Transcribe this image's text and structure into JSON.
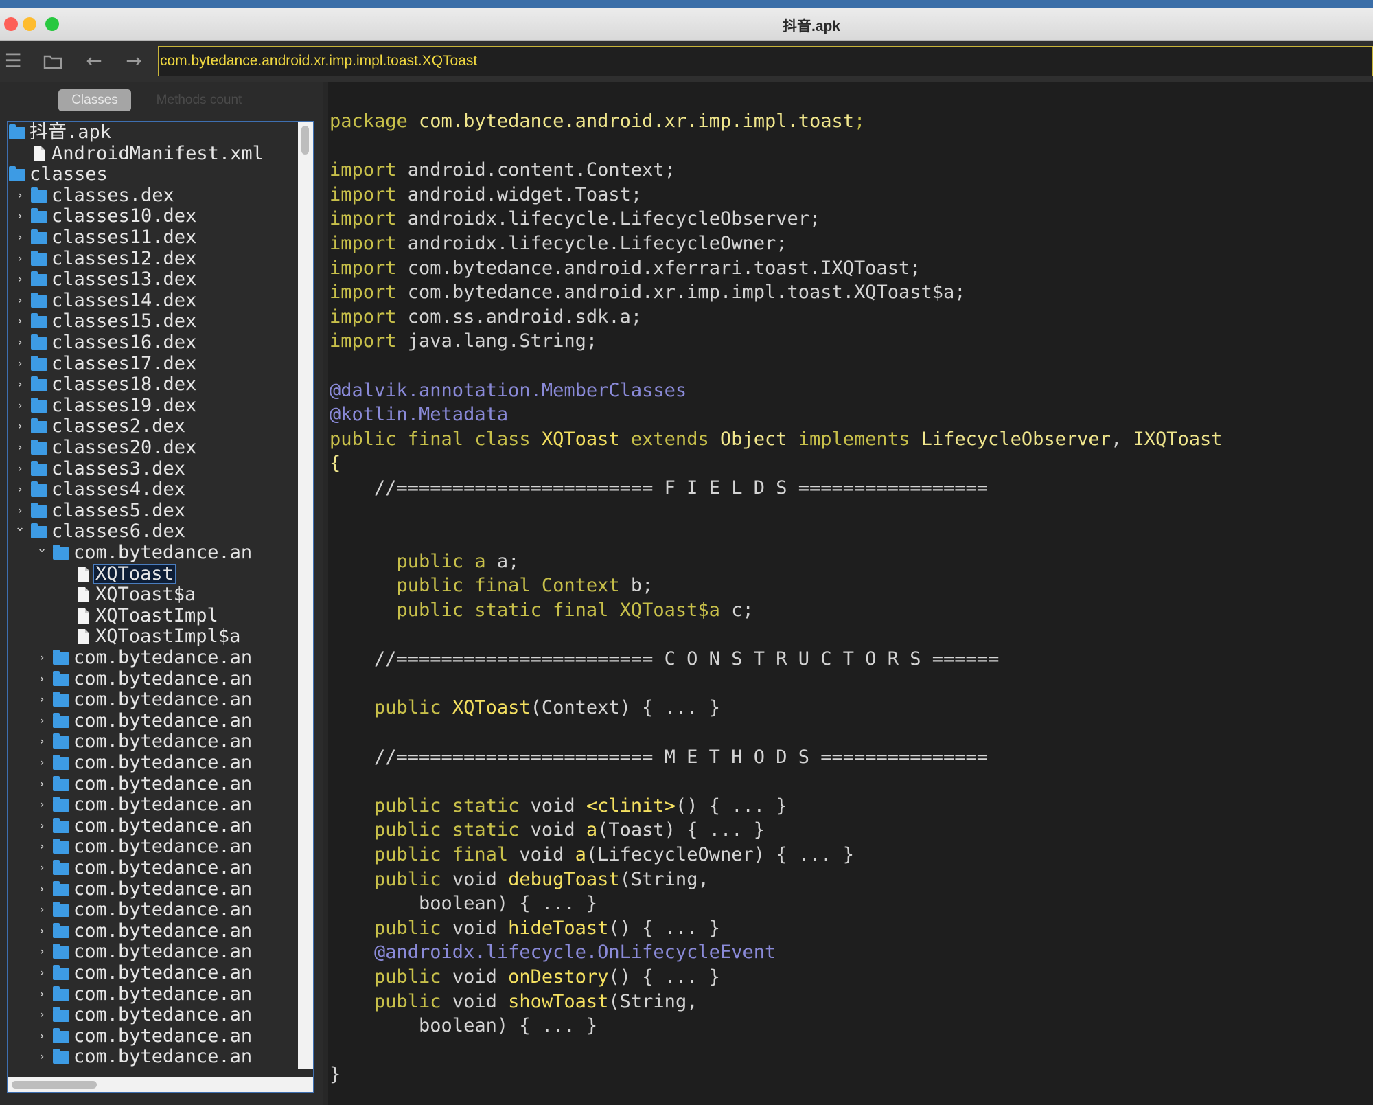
{
  "window": {
    "title": "抖音.apk",
    "address": "com.bytedance.android.xr.imp.impl.toast.XQToast",
    "colors": {
      "close": "#fd5f57",
      "minimize": "#febc2e",
      "maximize": "#28c840",
      "accent": "#3d9be4"
    }
  },
  "toolbar_icons": [
    "menu-icon",
    "folder-icon",
    "back-arrow-icon",
    "forward-arrow-icon"
  ],
  "tabs": {
    "classes": "Classes",
    "methods": "Methods count"
  },
  "tree": [
    {
      "text": "抖音.apk",
      "level": 0,
      "icon": "folder",
      "chev": ""
    },
    {
      "text": "AndroidManifest.xml",
      "level": 1,
      "icon": "file",
      "chev": ""
    },
    {
      "text": "classes",
      "level": 0,
      "icon": "folder",
      "chev": "v"
    },
    {
      "text": "classes.dex",
      "level": 1,
      "icon": "folder",
      "chev": ">"
    },
    {
      "text": "classes10.dex",
      "level": 1,
      "icon": "folder",
      "chev": ">"
    },
    {
      "text": "classes11.dex",
      "level": 1,
      "icon": "folder",
      "chev": ">"
    },
    {
      "text": "classes12.dex",
      "level": 1,
      "icon": "folder",
      "chev": ">"
    },
    {
      "text": "classes13.dex",
      "level": 1,
      "icon": "folder",
      "chev": ">"
    },
    {
      "text": "classes14.dex",
      "level": 1,
      "icon": "folder",
      "chev": ">"
    },
    {
      "text": "classes15.dex",
      "level": 1,
      "icon": "folder",
      "chev": ">"
    },
    {
      "text": "classes16.dex",
      "level": 1,
      "icon": "folder",
      "chev": ">"
    },
    {
      "text": "classes17.dex",
      "level": 1,
      "icon": "folder",
      "chev": ">"
    },
    {
      "text": "classes18.dex",
      "level": 1,
      "icon": "folder",
      "chev": ">"
    },
    {
      "text": "classes19.dex",
      "level": 1,
      "icon": "folder",
      "chev": ">"
    },
    {
      "text": "classes2.dex",
      "level": 1,
      "icon": "folder",
      "chev": ">"
    },
    {
      "text": "classes20.dex",
      "level": 1,
      "icon": "folder",
      "chev": ">"
    },
    {
      "text": "classes3.dex",
      "level": 1,
      "icon": "folder",
      "chev": ">"
    },
    {
      "text": "classes4.dex",
      "level": 1,
      "icon": "folder",
      "chev": ">"
    },
    {
      "text": "classes5.dex",
      "level": 1,
      "icon": "folder",
      "chev": ">"
    },
    {
      "text": "classes6.dex",
      "level": 1,
      "icon": "folder",
      "chev": "v"
    },
    {
      "text": "com.bytedance.an",
      "level": 2,
      "icon": "folder",
      "chev": "v"
    },
    {
      "text": "XQToast",
      "level": 3,
      "icon": "file",
      "chev": "",
      "selected": true
    },
    {
      "text": "XQToast$a",
      "level": 3,
      "icon": "file",
      "chev": ""
    },
    {
      "text": "XQToastImpl",
      "level": 3,
      "icon": "file",
      "chev": ""
    },
    {
      "text": "XQToastImpl$a",
      "level": 3,
      "icon": "file",
      "chev": ""
    },
    {
      "text": "com.bytedance.an",
      "level": 2,
      "icon": "folder",
      "chev": ">"
    },
    {
      "text": "com.bytedance.an",
      "level": 2,
      "icon": "folder",
      "chev": ">"
    },
    {
      "text": "com.bytedance.an",
      "level": 2,
      "icon": "folder",
      "chev": ">"
    },
    {
      "text": "com.bytedance.an",
      "level": 2,
      "icon": "folder",
      "chev": ">"
    },
    {
      "text": "com.bytedance.an",
      "level": 2,
      "icon": "folder",
      "chev": ">"
    },
    {
      "text": "com.bytedance.an",
      "level": 2,
      "icon": "folder",
      "chev": ">"
    },
    {
      "text": "com.bytedance.an",
      "level": 2,
      "icon": "folder",
      "chev": ">"
    },
    {
      "text": "com.bytedance.an",
      "level": 2,
      "icon": "folder",
      "chev": ">"
    },
    {
      "text": "com.bytedance.an",
      "level": 2,
      "icon": "folder",
      "chev": ">"
    },
    {
      "text": "com.bytedance.an",
      "level": 2,
      "icon": "folder",
      "chev": ">"
    },
    {
      "text": "com.bytedance.an",
      "level": 2,
      "icon": "folder",
      "chev": ">"
    },
    {
      "text": "com.bytedance.an",
      "level": 2,
      "icon": "folder",
      "chev": ">"
    },
    {
      "text": "com.bytedance.an",
      "level": 2,
      "icon": "folder",
      "chev": ">"
    },
    {
      "text": "com.bytedance.an",
      "level": 2,
      "icon": "folder",
      "chev": ">"
    },
    {
      "text": "com.bytedance.an",
      "level": 2,
      "icon": "folder",
      "chev": ">"
    },
    {
      "text": "com.bytedance.an",
      "level": 2,
      "icon": "folder",
      "chev": ">"
    },
    {
      "text": "com.bytedance.an",
      "level": 2,
      "icon": "folder",
      "chev": ">"
    },
    {
      "text": "com.bytedance.an",
      "level": 2,
      "icon": "folder",
      "chev": ">"
    },
    {
      "text": "com.bytedance.an",
      "level": 2,
      "icon": "folder",
      "chev": ">"
    },
    {
      "text": "com.bytedance.an",
      "level": 2,
      "icon": "folder",
      "chev": ">"
    }
  ],
  "code": [
    [
      [
        "kw",
        "package "
      ],
      [
        "ty",
        "com.bytedance.android.xr.imp.impl.toast"
      ],
      [
        "kw",
        ";"
      ]
    ],
    [],
    [
      [
        "kw",
        "import "
      ],
      [
        "",
        "android.content.Context;"
      ]
    ],
    [
      [
        "kw",
        "import "
      ],
      [
        "",
        "android.widget.Toast;"
      ]
    ],
    [
      [
        "kw",
        "import "
      ],
      [
        "",
        "androidx.lifecycle.LifecycleObserver;"
      ]
    ],
    [
      [
        "kw",
        "import "
      ],
      [
        "",
        "androidx.lifecycle.LifecycleOwner;"
      ]
    ],
    [
      [
        "kw",
        "import "
      ],
      [
        "",
        "com.bytedance.android.xferrari.toast.IXQToast;"
      ]
    ],
    [
      [
        "kw",
        "import "
      ],
      [
        "",
        "com.bytedance.android.xr.imp.impl.toast.XQToast$a;"
      ]
    ],
    [
      [
        "kw",
        "import "
      ],
      [
        "",
        "com.ss.android.sdk.a;"
      ]
    ],
    [
      [
        "kw",
        "import "
      ],
      [
        "",
        "java.lang.String;"
      ]
    ],
    [],
    [
      [
        "an",
        "@dalvik.annotation.MemberClasses"
      ]
    ],
    [
      [
        "an",
        "@kotlin.Metadata"
      ]
    ],
    [
      [
        "kw",
        "public final class "
      ],
      [
        "nm",
        "XQToast"
      ],
      [
        "kw",
        " extends "
      ],
      [
        "ty",
        "Object"
      ],
      [
        "kw",
        " implements "
      ],
      [
        "ty",
        "LifecycleObserver"
      ],
      [
        "",
        ", "
      ],
      [
        "ty",
        "IXQToast"
      ]
    ],
    [
      [
        "ty",
        "{"
      ]
    ],
    [
      [
        "",
        "    //======================= F I E L D S ================="
      ]
    ],
    [],
    [],
    [
      [
        "kw",
        "      public "
      ],
      [
        "kw",
        "a "
      ],
      [
        "",
        "a;"
      ]
    ],
    [
      [
        "kw",
        "      public final "
      ],
      [
        "kw",
        "Context "
      ],
      [
        "",
        "b;"
      ]
    ],
    [
      [
        "kw",
        "      public static final "
      ],
      [
        "kw",
        "XQToast$a "
      ],
      [
        "",
        "c;"
      ]
    ],
    [],
    [
      [
        "",
        "    //======================= C O N S T R U C T O R S ======"
      ]
    ],
    [],
    [
      [
        "kw",
        "    public "
      ],
      [
        "nm",
        "XQToast"
      ],
      [
        "",
        "(Context) { ... }"
      ]
    ],
    [],
    [
      [
        "",
        "    //======================= M E T H O D S ==============="
      ]
    ],
    [],
    [
      [
        "kw",
        "    public static "
      ],
      [
        "",
        "void "
      ],
      [
        "nm",
        "<clinit>"
      ],
      [
        "",
        "() { ... }"
      ]
    ],
    [
      [
        "kw",
        "    public static "
      ],
      [
        "",
        "void "
      ],
      [
        "nm",
        "a"
      ],
      [
        "",
        "(Toast) { ... }"
      ]
    ],
    [
      [
        "kw",
        "    public final "
      ],
      [
        "",
        "void "
      ],
      [
        "nm",
        "a"
      ],
      [
        "",
        "(LifecycleOwner) { ... }"
      ]
    ],
    [
      [
        "kw",
        "    public "
      ],
      [
        "",
        "void "
      ],
      [
        "nm",
        "debugToast"
      ],
      [
        "",
        "(String,"
      ]
    ],
    [
      [
        "",
        "        boolean) { ... }"
      ]
    ],
    [
      [
        "kw",
        "    public "
      ],
      [
        "",
        "void "
      ],
      [
        "nm",
        "hideToast"
      ],
      [
        "",
        "() { ... }"
      ]
    ],
    [
      [
        "an",
        "    @androidx.lifecycle.OnLifecycleEvent"
      ]
    ],
    [
      [
        "kw",
        "    public "
      ],
      [
        "",
        "void "
      ],
      [
        "nm",
        "onDestory"
      ],
      [
        "",
        "() { ... }"
      ]
    ],
    [
      [
        "kw",
        "    public "
      ],
      [
        "",
        "void "
      ],
      [
        "nm",
        "showToast"
      ],
      [
        "",
        "(String,"
      ]
    ],
    [
      [
        "",
        "        boolean) { ... }"
      ]
    ],
    [],
    [
      [
        "",
        "}"
      ]
    ]
  ]
}
